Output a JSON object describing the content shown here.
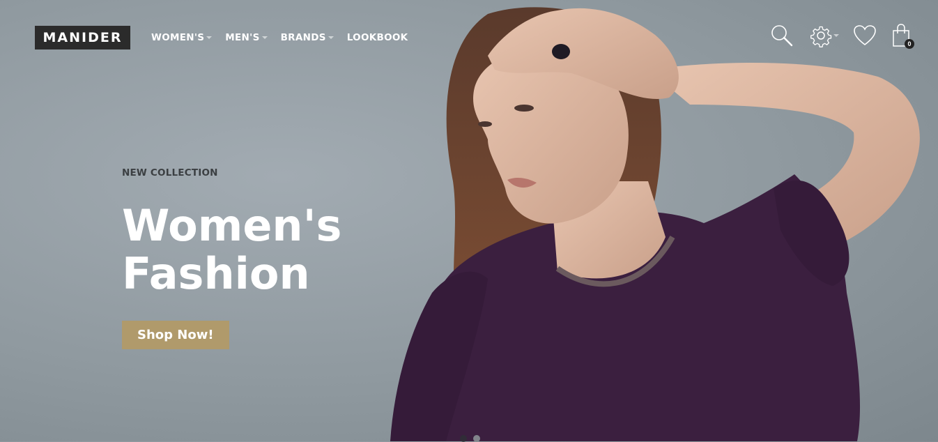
{
  "header": {
    "logo": "MANIDER",
    "nav": [
      {
        "label": "WOMEN'S",
        "has_dropdown": true
      },
      {
        "label": "MEN'S",
        "has_dropdown": true
      },
      {
        "label": "BRANDS",
        "has_dropdown": true
      },
      {
        "label": "LOOKBOOK",
        "has_dropdown": false
      }
    ],
    "icons": [
      "search-icon",
      "gear-icon",
      "heart-icon",
      "shopping-bag-icon"
    ],
    "cart_count": "0"
  },
  "hero": {
    "eyebrow": "NEW COLLECTION",
    "headline_line1": "Women's",
    "headline_line2": "Fashion",
    "cta_label": "Shop Now!"
  },
  "slider": {
    "slides": 2,
    "active": 1
  },
  "colors": {
    "logo_bg": "#2b2b2b",
    "cta_bg": "#b09a6b",
    "background": "#939da3",
    "dress": "#3b1f3f"
  }
}
